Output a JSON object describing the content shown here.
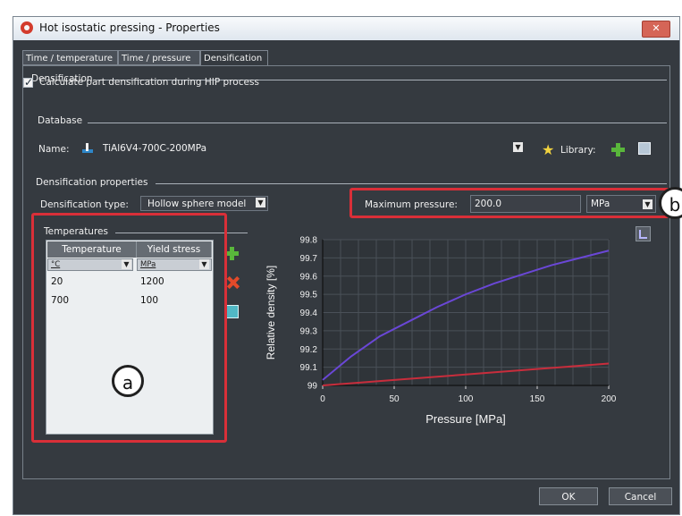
{
  "window": {
    "title": "Hot isostatic pressing - Properties",
    "close_glyph": "✕"
  },
  "tabs": [
    {
      "label": "Time / temperature",
      "active": false
    },
    {
      "label": "Time / pressure",
      "active": false
    },
    {
      "label": "Densification",
      "active": true
    }
  ],
  "densification": {
    "section_title": "Densification",
    "checkbox_label": "Calculate part densification during HIP process",
    "checked": true
  },
  "database": {
    "section_title": "Database",
    "name_label": "Name:",
    "name_value": "TiAl6V4-700C-200MPa",
    "library_label": "Library:"
  },
  "properties": {
    "section_title": "Densification properties",
    "type_label": "Densification type:",
    "type_value": "Hollow sphere model",
    "max_pressure_label": "Maximum pressure:",
    "max_pressure_value": "200.0",
    "pressure_unit": "MPa"
  },
  "temperatures": {
    "section_title": "Temperatures",
    "columns": [
      "Temperature",
      "Yield stress"
    ],
    "units": [
      "°C",
      "MPa"
    ],
    "rows": [
      [
        "20",
        "1200"
      ],
      [
        "700",
        "100"
      ]
    ]
  },
  "annotations": {
    "a": "a",
    "b": "b"
  },
  "buttons": {
    "ok": "OK",
    "cancel": "Cancel"
  },
  "colors": {
    "highlight_box": "#d92f38",
    "upper_curve": "#6a47d6",
    "lower_curve": "#c82d3c"
  },
  "icons": {
    "add": "plus-icon",
    "delete": "delete-icon",
    "trash": "trash-icon",
    "save": "save-icon",
    "library": "star-icon"
  },
  "chart_data": {
    "type": "line",
    "xlabel": "Pressure [MPa]",
    "ylabel": "Relative density [%]",
    "xlim": [
      0,
      200
    ],
    "ylim": [
      99,
      99.8
    ],
    "x_ticks": [
      0,
      50,
      100,
      150,
      200
    ],
    "y_ticks": [
      99,
      99.1,
      99.2,
      99.3,
      99.4,
      99.5,
      99.6,
      99.7,
      99.8
    ],
    "grid": true,
    "series": [
      {
        "x": [
          0,
          20,
          40,
          60,
          80,
          100,
          120,
          140,
          160,
          180,
          200
        ],
        "values": [
          99.03,
          99.16,
          99.27,
          99.35,
          99.43,
          99.5,
          99.56,
          99.61,
          99.66,
          99.7,
          99.74
        ]
      },
      {
        "x": [
          0,
          50,
          100,
          150,
          200
        ],
        "values": [
          99.0,
          99.03,
          99.06,
          99.09,
          99.12
        ]
      }
    ]
  }
}
